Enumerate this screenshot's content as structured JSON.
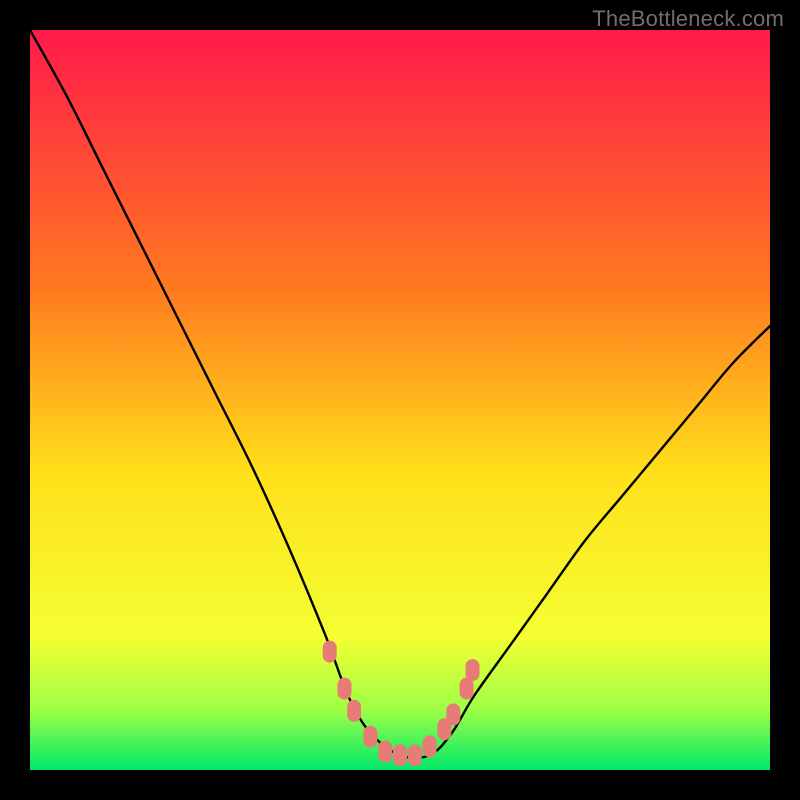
{
  "attribution": "TheBottleneck.com",
  "chart_data": {
    "type": "line",
    "title": "",
    "xlabel": "",
    "ylabel": "",
    "xlim": [
      0,
      100
    ],
    "ylim": [
      0,
      100
    ],
    "gradient_stops": [
      {
        "offset": 0,
        "color": "#ff1a4b"
      },
      {
        "offset": 35,
        "color": "#ff7a1f"
      },
      {
        "offset": 60,
        "color": "#ffe01a"
      },
      {
        "offset": 82,
        "color": "#f4ff33"
      },
      {
        "offset": 92,
        "color": "#9bff45"
      },
      {
        "offset": 100,
        "color": "#00e86b"
      }
    ],
    "series": [
      {
        "name": "bottleneck-curve",
        "x": [
          0,
          5,
          10,
          15,
          20,
          25,
          30,
          35,
          40,
          43,
          46,
          50,
          54,
          57,
          60,
          65,
          70,
          75,
          80,
          85,
          90,
          95,
          100
        ],
        "values": [
          100,
          91,
          81,
          71,
          61,
          51,
          41,
          30,
          18,
          10,
          5,
          2,
          2,
          5,
          10,
          17,
          24,
          31,
          37,
          43,
          49,
          55,
          60
        ]
      }
    ],
    "markers": {
      "name": "highlight-points",
      "color": "#e77b76",
      "points": [
        {
          "x": 40.5,
          "y": 16
        },
        {
          "x": 42.5,
          "y": 11
        },
        {
          "x": 43.8,
          "y": 8
        },
        {
          "x": 46.0,
          "y": 4.5
        },
        {
          "x": 48.0,
          "y": 2.5
        },
        {
          "x": 50.0,
          "y": 2.0
        },
        {
          "x": 52.0,
          "y": 2.0
        },
        {
          "x": 54.0,
          "y": 3.2
        },
        {
          "x": 56.0,
          "y": 5.5
        },
        {
          "x": 57.2,
          "y": 7.5
        },
        {
          "x": 59.0,
          "y": 11
        },
        {
          "x": 59.8,
          "y": 13.5
        }
      ]
    }
  }
}
